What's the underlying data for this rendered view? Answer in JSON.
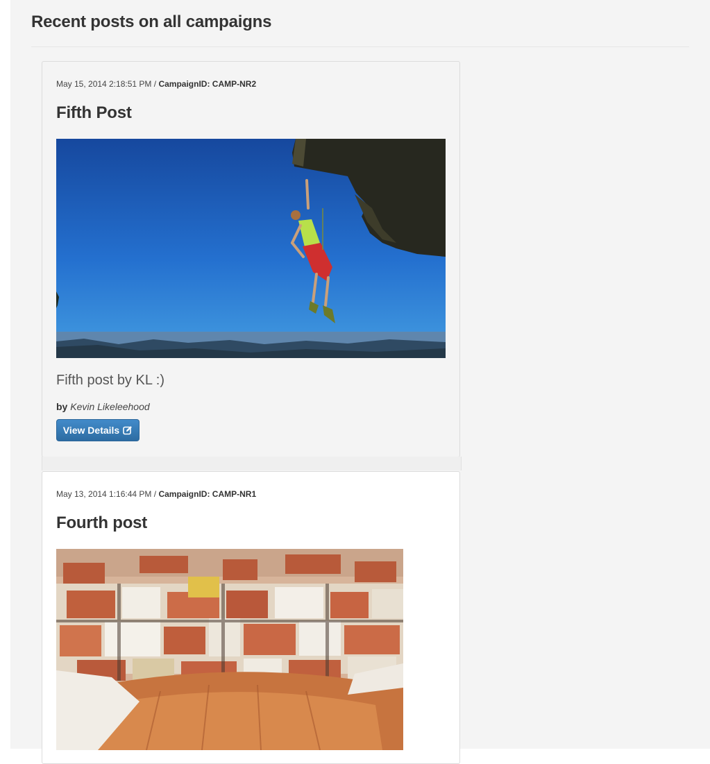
{
  "page": {
    "title": "Recent posts on all campaigns"
  },
  "posts": [
    {
      "date": "May 15, 2014 2:18:51 PM",
      "separator": "/",
      "campaign": "CampaignID: CAMP-NR2",
      "title": "Fifth Post",
      "image_icon": "rock-climber-photo",
      "body": "Fifth post by KL :)",
      "by_label": "by",
      "author": "Kevin Likeleehood",
      "button_label": "View Details",
      "button_icon": "edit-icon"
    },
    {
      "date": "May 13, 2014 1:16:44 PM",
      "separator": "/",
      "campaign": "CampaignID: CAMP-NR1",
      "title": "Fourth post",
      "image_icon": "city-rooftops-photo"
    }
  ],
  "colors": {
    "button": "#428bca",
    "sky": "#1e63c9",
    "roofs": "#c96a45"
  }
}
